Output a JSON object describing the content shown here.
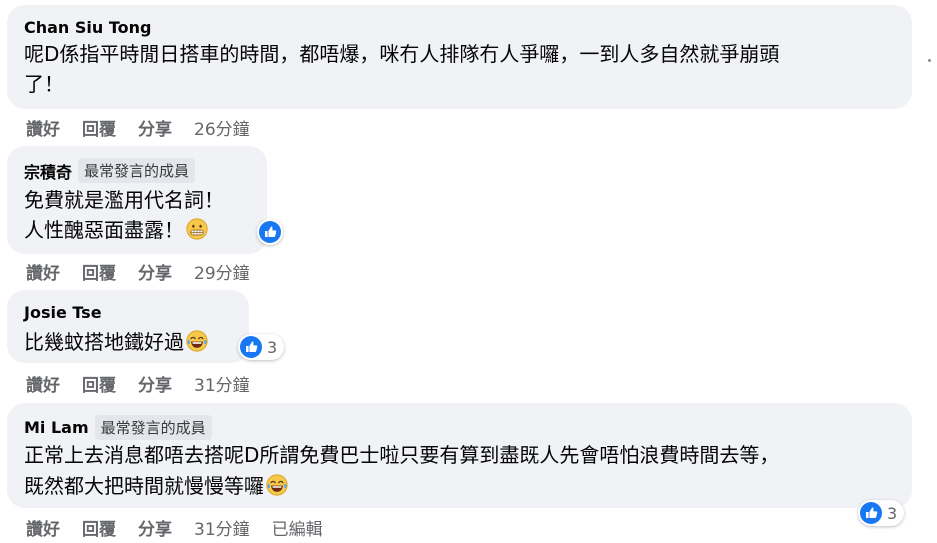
{
  "colors": {
    "bubble_bg": "#f0f2f5",
    "like_blue": "#1877f2",
    "meta_gray": "#65676b",
    "text": "#050505"
  },
  "actions": {
    "like": "讚好",
    "reply": "回覆",
    "share": "分享"
  },
  "comments": [
    {
      "author": "Chan Siu Tong",
      "badge": "",
      "lines": [
        "呢D係指平時閒日搭車的時間，都唔爆，咪冇人排隊冇人爭囉，一到人多自然就爭崩頭",
        "了！"
      ],
      "time": "26分鐘",
      "edited": "",
      "reaction_count": ""
    },
    {
      "author": "宗積奇",
      "badge": "最常發言的成員",
      "lines": [
        "免費就是濫用代名詞！",
        "人性醜惡面盡露！"
      ],
      "emoji": "grimacing-face",
      "time": "29分鐘",
      "edited": "",
      "reaction_count": ""
    },
    {
      "author": "Josie Tse",
      "badge": "",
      "lines": [
        "比幾蚊搭地鐵好過"
      ],
      "emoji": "laughing-tears-face",
      "time": "31分鐘",
      "edited": "",
      "reaction_count": "3"
    },
    {
      "author": "Mi Lam",
      "badge": "最常發言的成員",
      "lines": [
        "正常上去消息都唔去搭呢D所謂免費巴士啦只要有算到盡既人先會唔怕浪費時間去等，",
        "既然都大把時間就慢慢等囉"
      ],
      "emoji": "laughing-tears-face",
      "time": "31分鐘",
      "edited": "已編輯",
      "reaction_count": "3"
    }
  ]
}
